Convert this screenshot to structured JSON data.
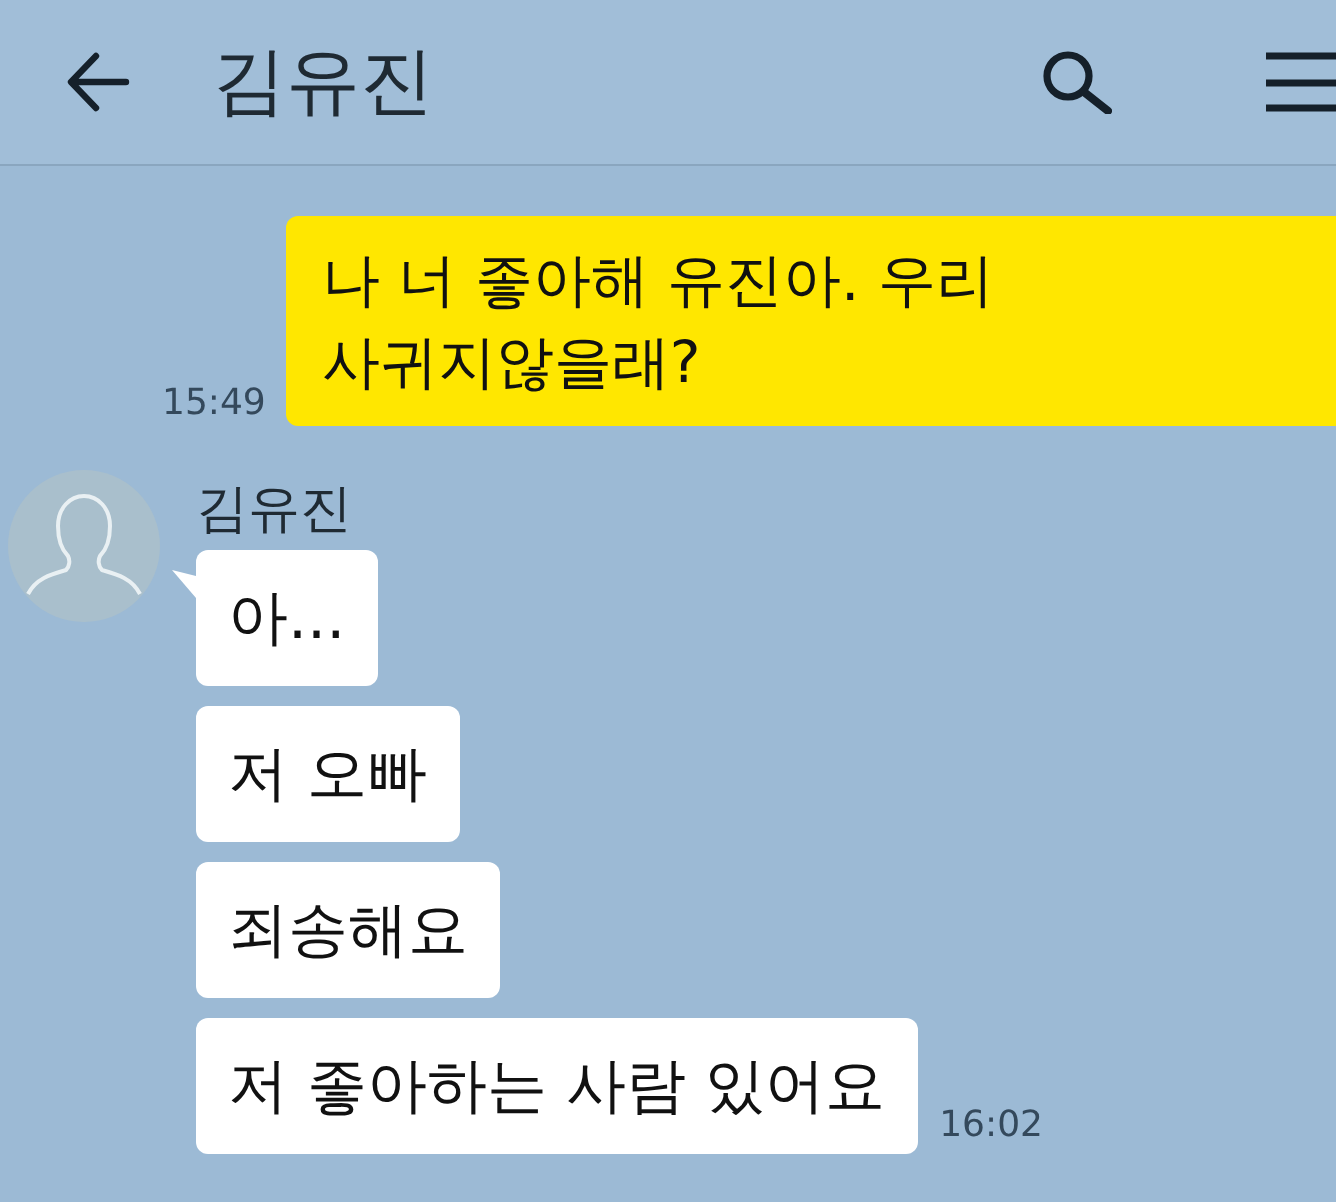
{
  "header": {
    "title": "김유진"
  },
  "messages": [
    {
      "kind": "outgoing",
      "text": "나 너 좋아해 유진아. 우리 사귀지않을래?",
      "time": "15:49"
    },
    {
      "kind": "incoming",
      "sender": "김유진",
      "bubbles": [
        "아...",
        "저 오빠",
        "죄송해요",
        "저 좋아하는 사람 있어요"
      ],
      "time": "16:02"
    }
  ]
}
